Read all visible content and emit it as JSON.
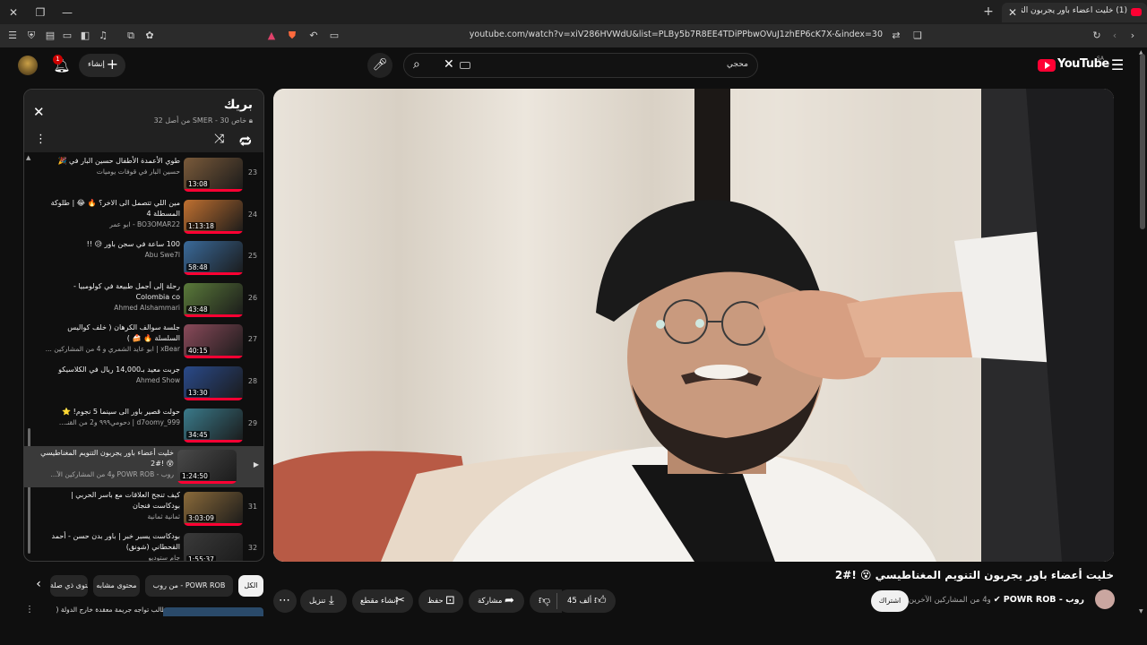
{
  "browser": {
    "tab": {
      "title": "(1) خليت أعضاء باور يجربون التنو"
    },
    "url": "youtube.com/watch?v=xiV286HVWdU&list=PLBy5b7R8EE4TDiPPbwOVuJ1zhEP6cK7X-&index=30"
  },
  "header": {
    "notifications_count": "1",
    "create_label": "إنشاء",
    "search_value": "محجي",
    "logo_text": "YouTube",
    "region": "SA"
  },
  "playlist": {
    "title": "بريك",
    "subtitle": "خاص SMER - 30 من أصل 32",
    "items": [
      {
        "index": "23",
        "title": "طوي الأعمدة الأطفال حسين البار في 🎉",
        "channel": "حسين البار في قوفات يوميات",
        "duration": "13:08"
      },
      {
        "index": "24",
        "title": "مين اللي تتصمل الى الاخر؟ 🔥 😂 | طلوكة المسطلة 4",
        "channel": "BO3OMAR22 - ابو عمر",
        "duration": "1:13:18"
      },
      {
        "index": "25",
        "title": "100 ساعة في سجن باور 😥 !!",
        "channel": "Abu Swe7l",
        "duration": "58:48"
      },
      {
        "index": "26",
        "title": "رحلة إلى أجمل طبيعة في كولومبيا - Colombia co",
        "channel": "Ahmed Alshammari",
        "duration": "43:48"
      },
      {
        "index": "27",
        "title": "جلسة سوالف الكرهان ( خلف كواليس السلسلة 🔥 🍰 )",
        "channel": "xBear | ابو عايد الشمري و 4 من المشاركين ...",
        "duration": "40:15"
      },
      {
        "index": "28",
        "title": "جربت معيد بـ14,000 ريال في الكلاسيكو",
        "channel": "Ahmed Show",
        "duration": "13:30"
      },
      {
        "index": "29",
        "title": "حولت قصير باور الى سينما 5 نجوم! ⭐",
        "channel": "d7oomy_999 | دحومي٩٩٩ و2 من القنـ...",
        "duration": "34:45"
      },
      {
        "index": "30",
        "title": "خليت أعضاء باور يجربون التنويم المغناطيسي 😵 !#2",
        "channel": "روب - POWR ROB و4 من المشاركين الآ...",
        "duration": "1:24:50"
      },
      {
        "index": "31",
        "title": "كيف تنجح العلاقات مع باسر الحربي | بودكاست فنجان",
        "channel": "ثمانية ثمانية",
        "duration": "3:03:09"
      },
      {
        "index": "32",
        "title": "بودكاست يسبر خبر | باور بدن حسن - أحمد القحطاني (شونق)",
        "channel": "جام ستوديو",
        "duration": "1:55:37"
      }
    ]
  },
  "video": {
    "title": "خليت أعضاء باور يجربون التنويم المغناطيسي 😵 !#2",
    "channel_name": "روب - POWR ROB",
    "channel_extra": "و4 من المشاركين الآخرين",
    "subscribe_label": "اشتراك",
    "likes": "45 ألف",
    "share_label": "مشاركة",
    "save_label": "حفظ",
    "clip_label": "إنشاء مقطع",
    "download_label": "تنزيل"
  },
  "chips": {
    "items": [
      "الكل",
      "من روب - POWR ROB",
      "محتوى مشابه",
      "محتوى ذي صلة"
    ]
  },
  "next_up": {
    "title": "قصة طالب تواجه جريمة معقدة خارج الدولة ("
  },
  "colors": {
    "brand": "#ff0033",
    "background": "#0f0f0f",
    "chip": "#272727"
  }
}
